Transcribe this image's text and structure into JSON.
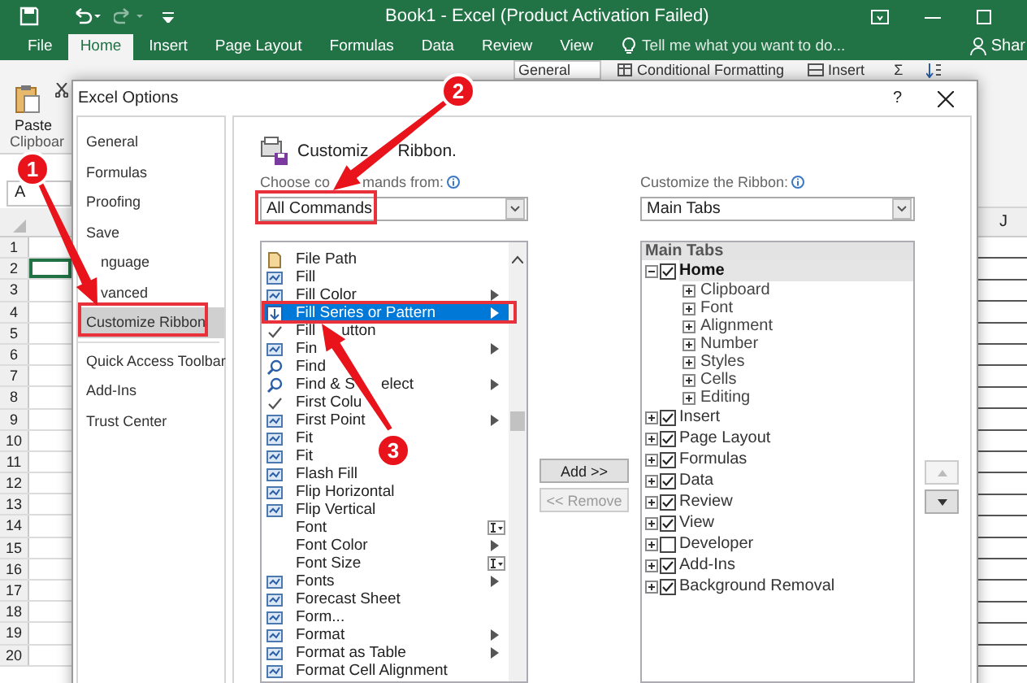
{
  "excel": {
    "title": "Book1 - Excel (Product Activation Failed)",
    "tabs": [
      {
        "label": "File",
        "selected": false
      },
      {
        "label": "Home",
        "selected": true
      },
      {
        "label": "Insert",
        "selected": false
      },
      {
        "label": "Page Layout",
        "selected": false
      },
      {
        "label": "Formulas",
        "selected": false
      },
      {
        "label": "Data",
        "selected": false
      },
      {
        "label": "Review",
        "selected": false
      },
      {
        "label": "View",
        "selected": false
      }
    ],
    "tell_me": "Tell me what you want to do...",
    "share": "Shar",
    "ribbon": {
      "paste": "Paste",
      "clipboard": "Clipboar",
      "number_format": "General",
      "conditional_formatting": "Conditional Formatting",
      "insert": "Insert",
      "autosum": "Σ"
    },
    "name_box": "A",
    "rows": [
      "1",
      "2",
      "3",
      "4",
      "5",
      "6",
      "7",
      "8",
      "9",
      "10",
      "11",
      "12",
      "13",
      "14",
      "15",
      "16",
      "17",
      "18",
      "19",
      "20"
    ],
    "column": "J"
  },
  "dialog": {
    "title": "Excel Options",
    "help": "?",
    "nav": [
      {
        "label": "General",
        "selected": false
      },
      {
        "label": "Formulas",
        "selected": false
      },
      {
        "label": "Proofing",
        "selected": false
      },
      {
        "label": "Save",
        "selected": false
      },
      {
        "label": "nguage",
        "selected": false,
        "kind": "cut"
      },
      {
        "label": "vanced",
        "selected": false,
        "kind": "cut"
      },
      {
        "label": "Customize Ribbon",
        "selected": true
      },
      {
        "label": "Quick Access Toolbar",
        "selected": false,
        "kind": "divider"
      },
      {
        "label": "Add-Ins",
        "selected": false
      },
      {
        "label": "Trust Center",
        "selected": false
      }
    ],
    "header": [
      "Customiz",
      "Ribbon."
    ],
    "choose": {
      "label": [
        "Choose co",
        "mands from:"
      ],
      "value": "All Commands"
    },
    "commands": [
      {
        "label": "File Path",
        "selected": false
      },
      {
        "label": "Fill",
        "selected": false
      },
      {
        "label": "Fill Color",
        "selected": false,
        "kind": "submenu"
      },
      {
        "label": "Fill Series or Pattern",
        "selected": true,
        "kind": "submenu"
      },
      {
        "label": "Fill",
        "tail": "utton",
        "selected": false
      },
      {
        "label": "Fin",
        "selected": false,
        "kind": "submenu"
      },
      {
        "label": "Find",
        "selected": false
      },
      {
        "label": "Find & S",
        "tail": "elect",
        "selected": false,
        "kind": "submenu"
      },
      {
        "label": "First Colu",
        "selected": false
      },
      {
        "label": "First Point",
        "selected": false,
        "kind": "submenu"
      },
      {
        "label": "Fit",
        "selected": false
      },
      {
        "label": "Fit",
        "selected": false
      },
      {
        "label": "Flash Fill",
        "selected": false
      },
      {
        "label": "Flip Horizontal",
        "selected": false
      },
      {
        "label": "Flip Vertical",
        "selected": false
      },
      {
        "label": "Font",
        "selected": false,
        "kind": "field"
      },
      {
        "label": "Font Color",
        "selected": false,
        "kind": "submenu"
      },
      {
        "label": "Font Size",
        "selected": false,
        "kind": "field"
      },
      {
        "label": "Fonts",
        "selected": false,
        "kind": "submenu"
      },
      {
        "label": "Forecast Sheet",
        "selected": false
      },
      {
        "label": "Form...",
        "selected": false
      },
      {
        "label": "Format",
        "selected": false,
        "kind": "submenu"
      },
      {
        "label": "Format as Table",
        "selected": false,
        "kind": "submenu"
      },
      {
        "label": "Format Cell Alignment",
        "selected": false
      }
    ],
    "buttons": [
      {
        "label": "Add >>",
        "disabled": false
      },
      {
        "label": "<< Remove",
        "disabled": true
      }
    ],
    "customize": {
      "label": "Customize the Ribbon:",
      "value": "Main Tabs"
    },
    "tree": {
      "header": "Main Tabs",
      "items": [
        {
          "label": "Home",
          "checked": true,
          "expanded": true,
          "selected": true,
          "children": [
            {
              "label": "Clipboard",
              "expanded": false
            },
            {
              "label": "Font",
              "expanded": false
            },
            {
              "label": "Alignment",
              "expanded": false
            },
            {
              "label": "Number",
              "expanded": false
            },
            {
              "label": "Styles",
              "expanded": false
            },
            {
              "label": "Cells",
              "expanded": false
            },
            {
              "label": "Editing",
              "expanded": false
            }
          ]
        },
        {
          "label": "Insert",
          "checked": true,
          "expanded": false,
          "selected": false
        },
        {
          "label": "Page Layout",
          "checked": true,
          "expanded": false,
          "selected": false
        },
        {
          "label": "Formulas",
          "checked": true,
          "expanded": false,
          "selected": false
        },
        {
          "label": "Data",
          "checked": true,
          "expanded": false,
          "selected": false
        },
        {
          "label": "Review",
          "checked": true,
          "expanded": false,
          "selected": false
        },
        {
          "label": "View",
          "checked": true,
          "expanded": false,
          "selected": false
        },
        {
          "label": "Developer",
          "checked": false,
          "expanded": false,
          "selected": false
        },
        {
          "label": "Add-Ins",
          "checked": true,
          "expanded": false,
          "selected": false
        },
        {
          "label": "Background Removal",
          "checked": true,
          "expanded": false,
          "selected": false
        }
      ]
    },
    "move": [
      {
        "kind": "up",
        "disabled": true
      },
      {
        "kind": "down",
        "disabled": false
      }
    ]
  },
  "annotations": [
    {
      "number": "1"
    },
    {
      "number": "2"
    },
    {
      "number": "3"
    }
  ]
}
